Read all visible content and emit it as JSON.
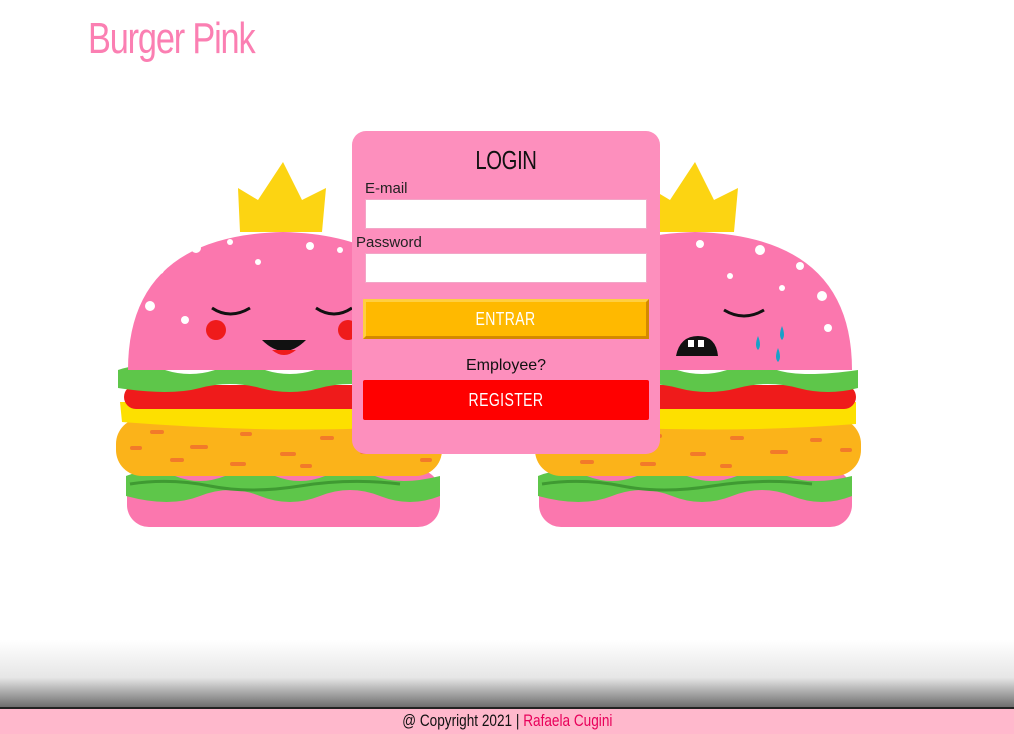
{
  "brand": {
    "title": "Burger Pink",
    "color": "#fb7fb2"
  },
  "login": {
    "title": "LOGIN",
    "email_label": "E-mail",
    "email_value": "",
    "password_label": "Password",
    "password_value": "",
    "submit_label": "ENTRAR",
    "employee_prompt": "Employee?",
    "register_label": "REGISTER"
  },
  "footer": {
    "copyright": "@ Copyright 2021 |",
    "author": "Rafaela Cugini"
  },
  "illustration": {
    "left_burger": "happy-crowned-burger",
    "right_burger": "crying-crowned-burger"
  },
  "colors": {
    "card": "#fd8fbd",
    "entrar": "#ffb900",
    "register": "#ff0000",
    "footer": "#ffb8cc",
    "link": "#e8005a"
  }
}
